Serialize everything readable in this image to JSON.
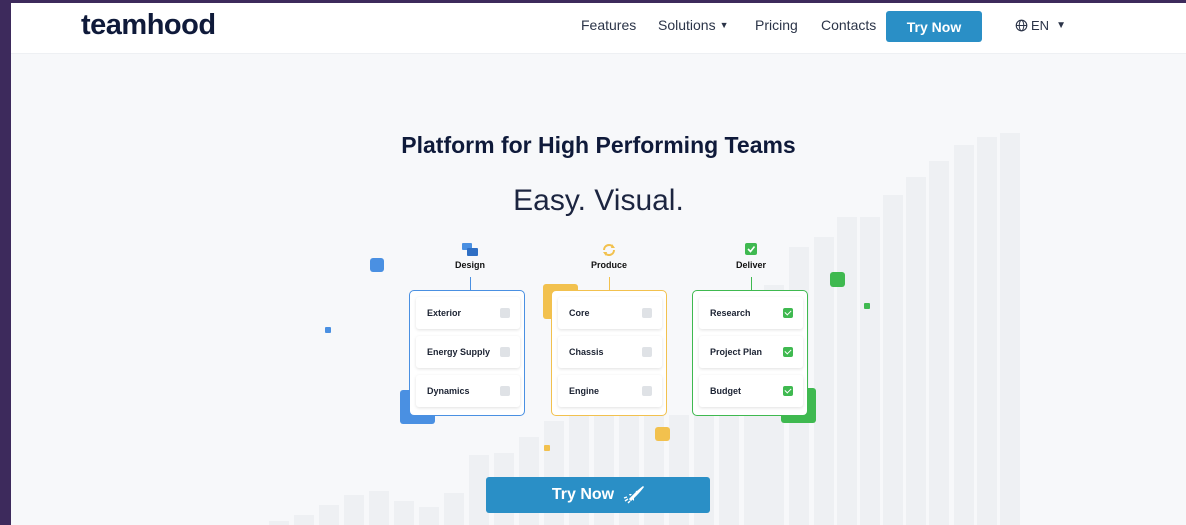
{
  "brand": {
    "logo_text": "teamhood",
    "accent": "#2a8fc6"
  },
  "nav": {
    "features": "Features",
    "solutions": "Solutions",
    "solutions_icon": "chevron-down-icon",
    "pricing": "Pricing",
    "contacts": "Contacts",
    "try_now": "Try Now",
    "lang": "EN",
    "lang_icon": "globe-icon"
  },
  "hero": {
    "title": "Platform for High Performing Teams",
    "subtitle": "Easy. Visual.",
    "cta": "Try Now",
    "cta_icon": "rocket-icon"
  },
  "columns": [
    {
      "name": "Design",
      "icon": "chat-bubbles-icon",
      "color": "#4a90e2",
      "items": [
        {
          "label": "Exterior",
          "done": false
        },
        {
          "label": "Energy Supply",
          "done": false
        },
        {
          "label": "Dynamics",
          "done": false
        }
      ]
    },
    {
      "name": "Produce",
      "icon": "refresh-icon",
      "color": "#f2c14e",
      "items": [
        {
          "label": "Core",
          "done": false
        },
        {
          "label": "Chassis",
          "done": false
        },
        {
          "label": "Engine",
          "done": false
        }
      ]
    },
    {
      "name": "Deliver",
      "icon": "check-square-icon",
      "color": "#3fb950",
      "items": [
        {
          "label": "Research",
          "done": true
        },
        {
          "label": "Project Plan",
          "done": true
        },
        {
          "label": "Budget",
          "done": true
        }
      ]
    }
  ]
}
